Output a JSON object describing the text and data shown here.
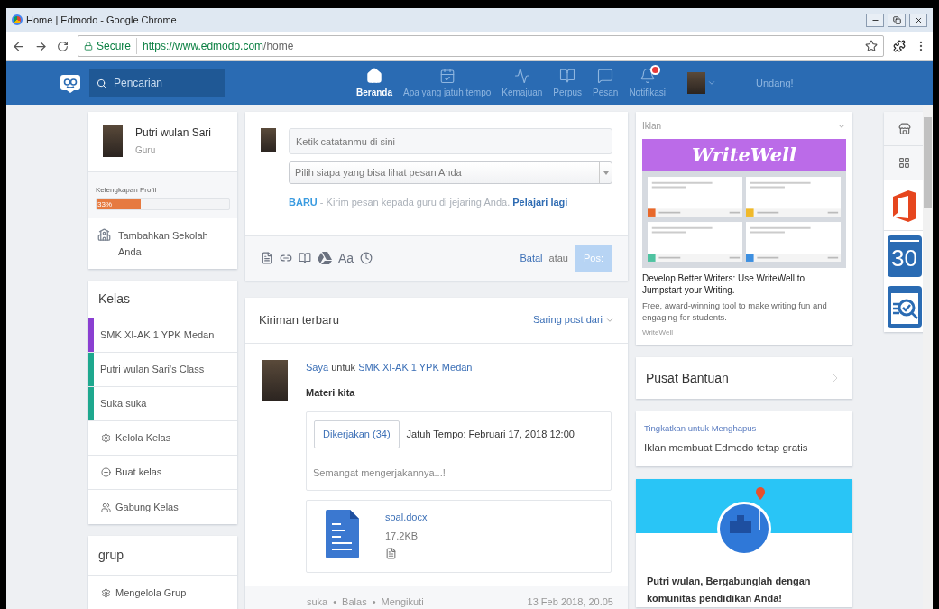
{
  "window": {
    "title": "Home | Edmodo - Google Chrome"
  },
  "address_bar": {
    "secure_label": "Secure",
    "url_host": "https://www.edmodo.com",
    "url_path": "/home"
  },
  "nav": {
    "search_placeholder": "Pencarian",
    "items": [
      {
        "label": "Beranda",
        "selected": true
      },
      {
        "label": "Apa yang jatuh tempo",
        "selected": false
      },
      {
        "label": "Kemajuan",
        "selected": false
      },
      {
        "label": "Perpus",
        "selected": false
      },
      {
        "label": "Pesan",
        "selected": false
      },
      {
        "label": "Notifikasi",
        "selected": false
      }
    ],
    "notification_badge": true,
    "invite": "Undang!"
  },
  "profile": {
    "name": "Putri wulan Sari",
    "role": "Guru",
    "completeness_label": "Kelengkapan Profil",
    "completeness": {
      "level": 0.33,
      "reading": "33%"
    },
    "add_school": "Tambahkan Sekolah Anda"
  },
  "classes": {
    "title": "Kelas",
    "items": [
      {
        "name": "SMK XI-AK 1 YPK Medan",
        "color": "#8a3fd1"
      },
      {
        "name": "Putri wulan Sari's Class",
        "color": "#1ea88e"
      },
      {
        "name": "Suka suka",
        "color": "#1ea88e"
      }
    ],
    "actions": [
      "Kelola Kelas",
      "Buat kelas",
      "Gabung Kelas"
    ]
  },
  "groups": {
    "title": "grup",
    "actions": [
      "Mengelola Grup"
    ]
  },
  "composer": {
    "note_placeholder": "Ketik catatanmu di sini",
    "audience_placeholder": "Pilih siapa yang bisa lihat pesan Anda",
    "notice": "**BARU** - Kirim pesan kepada guru di jejaring Anda.",
    "notice_link": "Pelajari lagi",
    "text_tool": "Aa",
    "cancel": "Batal",
    "or": "atau",
    "post": "Pos:",
    "post_disabled": true
  },
  "feed": {
    "title": "Kiriman terbaru",
    "filter": "Saring post dari",
    "post": {
      "author": "Saya",
      "connector": "untuk",
      "target": "SMK XI-AK 1 YPK Medan",
      "title": "Materi kita",
      "turned_in": "Dikerjakan (34)",
      "due": "Jatuh Tempo: Februari 17, 2018 12:00",
      "description": "Semangat mengerjakannya...!",
      "file_name": "soal.docx",
      "file_size": "17.2KB",
      "actions": [
        "suka",
        "Balas",
        "Mengikuti"
      ],
      "separator": "•",
      "timestamp": "13 Feb 2018, 20.05"
    }
  },
  "ad": {
    "label": "Iklan",
    "logo": "WriteWell",
    "headline": "Develop Better Writers: Use WriteWell to Jumpstart your Writing.",
    "body": "Free, award-winning tool to make writing fun and engaging for students.",
    "sponsor": "WriteWell"
  },
  "help": {
    "title": "Pusat Bantuan"
  },
  "upgrade": {
    "link": "Tingkatkan untuk Menghapus",
    "text": "Iklan membuat Edmodo tetap gratis"
  },
  "join_card": {
    "text": "Putri wulan, Bergabunglah dengan komunitas pendidikan Anda!"
  },
  "apps": [
    {
      "kind": "store"
    },
    {
      "kind": "grid"
    },
    {
      "kind": "office"
    },
    {
      "kind": "calendar",
      "label": "30"
    },
    {
      "kind": "search"
    }
  ]
}
